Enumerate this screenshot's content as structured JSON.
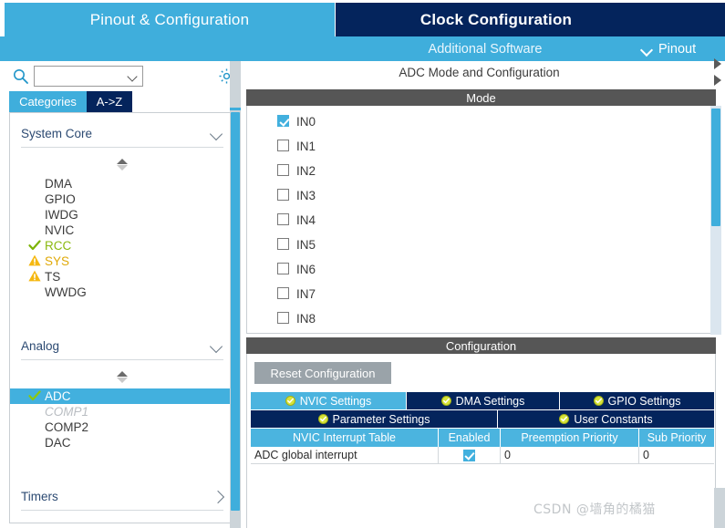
{
  "header": {
    "tab_pinout_configuration": "Pinout & Configuration",
    "tab_clock_configuration": "Clock Configuration",
    "additional_software": "Additional Software",
    "pinout_label": "Pinout"
  },
  "sidebar": {
    "search_placeholder": "",
    "search_value": "",
    "search_icon": "search-icon",
    "gear_icon": "gear-icon",
    "tabs": [
      {
        "label": "Categories",
        "active": true
      },
      {
        "label": "A->Z",
        "active": false
      }
    ],
    "groups": [
      {
        "title": "System Core",
        "expanded": true,
        "items": [
          {
            "label": "DMA",
            "mark": "none",
            "state": "normal"
          },
          {
            "label": "GPIO",
            "mark": "none",
            "state": "normal"
          },
          {
            "label": "IWDG",
            "mark": "none",
            "state": "normal"
          },
          {
            "label": "NVIC",
            "mark": "none",
            "state": "normal"
          },
          {
            "label": "RCC",
            "mark": "check",
            "state": "configured"
          },
          {
            "label": "SYS",
            "mark": "warn",
            "state": "warning"
          },
          {
            "label": "TS",
            "mark": "warn",
            "state": "warning"
          },
          {
            "label": "WWDG",
            "mark": "none",
            "state": "normal"
          }
        ]
      },
      {
        "title": "Analog",
        "expanded": true,
        "items": [
          {
            "label": "ADC",
            "mark": "check",
            "state": "selected"
          },
          {
            "label": "COMP1",
            "mark": "none",
            "state": "disabled"
          },
          {
            "label": "COMP2",
            "mark": "none",
            "state": "normal"
          },
          {
            "label": "DAC",
            "mark": "none",
            "state": "normal"
          }
        ]
      },
      {
        "title": "Timers",
        "expanded": false,
        "items": []
      }
    ]
  },
  "main": {
    "title": "ADC Mode and Configuration",
    "mode_section_title": "Mode",
    "mode_channels": [
      {
        "label": "IN0",
        "checked": true
      },
      {
        "label": "IN1",
        "checked": false
      },
      {
        "label": "IN2",
        "checked": false
      },
      {
        "label": "IN3",
        "checked": false
      },
      {
        "label": "IN4",
        "checked": false
      },
      {
        "label": "IN5",
        "checked": false
      },
      {
        "label": "IN6",
        "checked": false
      },
      {
        "label": "IN7",
        "checked": false
      },
      {
        "label": "IN8",
        "checked": false
      }
    ],
    "configuration_section_title": "Configuration",
    "reset_button": "Reset Configuration",
    "config_tabs_row1": [
      {
        "label": "NVIC Settings",
        "active": true
      },
      {
        "label": "DMA Settings",
        "active": false
      },
      {
        "label": "GPIO Settings",
        "active": false
      }
    ],
    "config_tabs_row2": [
      {
        "label": "Parameter Settings",
        "active": false
      },
      {
        "label": "User Constants",
        "active": false
      }
    ],
    "nvic_table": {
      "columns": [
        "NVIC Interrupt Table",
        "Enabled",
        "Preemption Priority",
        "Sub Priority"
      ],
      "rows": [
        {
          "interrupt": "ADC global interrupt",
          "enabled": true,
          "preemption_priority": "0",
          "sub_priority": "0"
        }
      ]
    }
  },
  "watermark": "CSDN @墙角的橘猫",
  "colors": {
    "accent_blue": "#3FAEDC",
    "tab_navy": "#04245C",
    "section_gray": "#565656",
    "check_green": "#8ab90f",
    "warn_amber": "#f2b705",
    "table_header_blue": "#4BB4DF"
  }
}
